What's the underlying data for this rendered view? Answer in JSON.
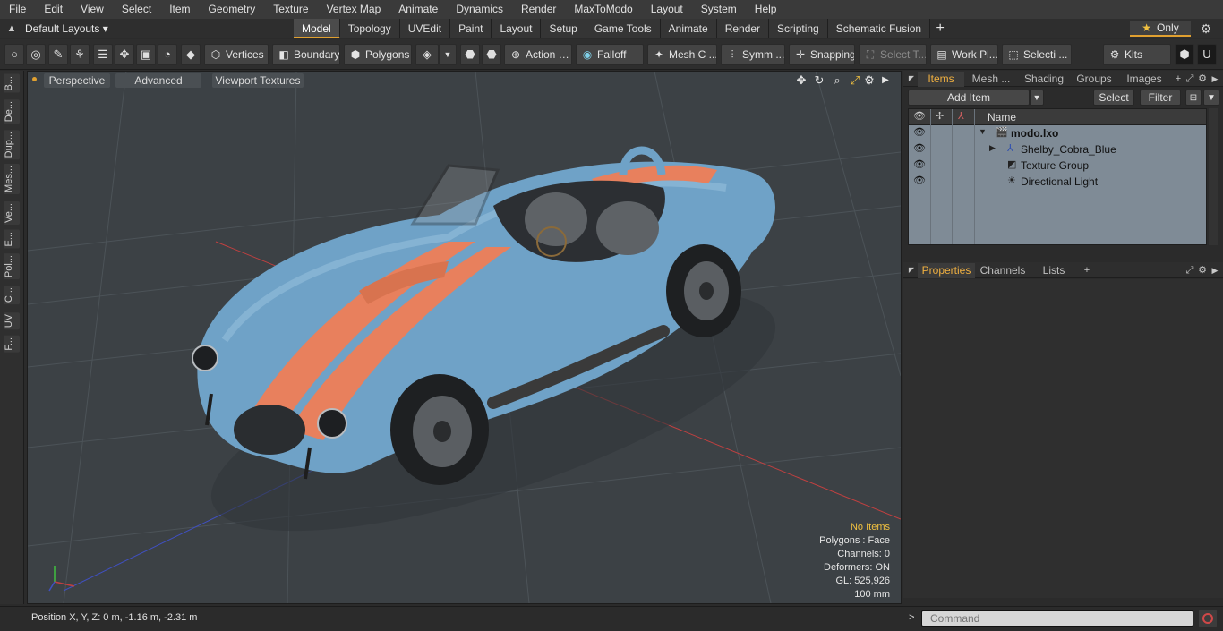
{
  "menubar": {
    "items": [
      "File",
      "Edit",
      "View",
      "Select",
      "Item",
      "Geometry",
      "Texture",
      "Vertex Map",
      "Animate",
      "Dynamics",
      "Render",
      "MaxToModo",
      "Layout",
      "System",
      "Help"
    ]
  },
  "layout": {
    "selector": "Default Layouts ▾",
    "tabs": [
      "Model",
      "Topology",
      "UVEdit",
      "Paint",
      "Layout",
      "Setup",
      "Game Tools",
      "Animate",
      "Render",
      "Scripting",
      "Schematic Fusion"
    ],
    "active_tab": "Model",
    "add_tab": "+",
    "only": "Only"
  },
  "toolbar": {
    "vertices": "Vertices",
    "boundary": "Boundary",
    "polygons": "Polygons",
    "action": "Action",
    "falloff": "Falloff",
    "mesh": "Mesh C ...",
    "symmetry": "Symm ...",
    "snapping": "Snapping",
    "select_t": "Select T...",
    "work_plane": "Work Pl...",
    "selection": "Selecti ...",
    "kits": "Kits"
  },
  "leftstrip": {
    "tabs": [
      "B...",
      "De...",
      "Dup...",
      "Mes...",
      "Ve...",
      "E...",
      "Pol...",
      "C...",
      "UV",
      "F..."
    ]
  },
  "viewport": {
    "view": "Perspective",
    "shading": "Advanced",
    "textures": "Viewport Textures",
    "info": {
      "no_items": "No Items",
      "polygons": "Polygons : Face",
      "channels": "Channels: 0",
      "deformers": "Deformers: ON",
      "gl": "GL: 525,926",
      "scale": "100 mm"
    }
  },
  "status": {
    "position": "Position X, Y, Z:   0 m, -1.16 m, -2.31 m"
  },
  "items_panel": {
    "tabs": [
      "Items",
      "Mesh ...",
      "Shading",
      "Groups",
      "Images"
    ],
    "active_tab": "Items",
    "add_item": "Add Item",
    "select": "Select",
    "filter": "Filter",
    "column_name": "Name",
    "items": [
      {
        "name": "modo.lxo",
        "level": 0,
        "icon": "scene-icon"
      },
      {
        "name": "Shelby_Cobra_Blue",
        "level": 1,
        "icon": "mesh-icon"
      },
      {
        "name": "Texture Group",
        "level": 1,
        "icon": "texture-group-icon"
      },
      {
        "name": "Directional Light",
        "level": 1,
        "icon": "light-icon"
      }
    ]
  },
  "properties_panel": {
    "tabs": [
      "Properties",
      "Channels",
      "Lists"
    ],
    "active_tab": "Properties",
    "add_tab": "+"
  },
  "command": {
    "placeholder": "Command"
  },
  "colors": {
    "accent": "#e0a030",
    "car_body": "#6fa2c7",
    "car_stripe": "#e8805d",
    "viewport_bg": "#3c4145",
    "item_list_bg": "#7f8b96"
  }
}
